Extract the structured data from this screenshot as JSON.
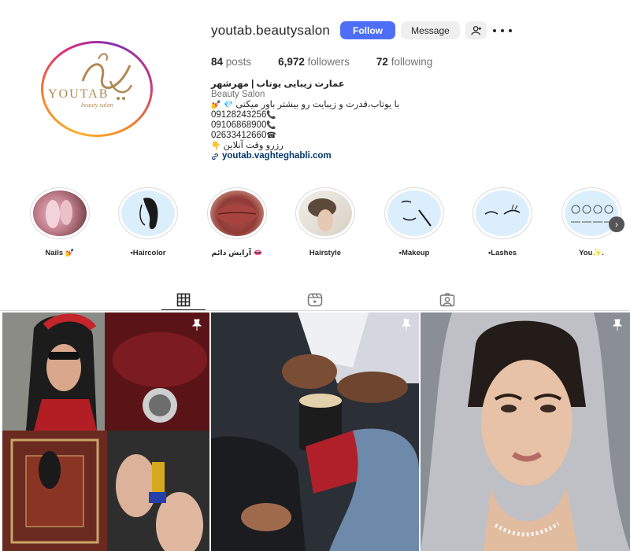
{
  "profile": {
    "username": "youtab.beautysalon",
    "avatar_logo_text": "YOUTAB",
    "avatar_logo_sub": "beauty salon",
    "buttons": {
      "follow": "Follow",
      "message": "Message"
    },
    "stats": {
      "posts_count": "84",
      "posts_label": "posts",
      "followers_count": "6,972",
      "followers_label": "followers",
      "following_count": "72",
      "following_label": "following"
    },
    "bio": {
      "name": "عمارت زیبایی یوتاب | مهرشهر",
      "category": "Beauty Salon",
      "line1": "با یوتاب،قدرت و زیبایت رو بیشتر باور میکنی",
      "phone1": "09128243256",
      "phone2": "09106868900",
      "phone3": "02633412660",
      "booking": "رزرو وقت آنلاین",
      "link": "youtab.vaghteghabli.com"
    }
  },
  "highlights": [
    {
      "label": "Nails 💅"
    },
    {
      "label": "•Haircolor"
    },
    {
      "label": "آرایش دائم 👄"
    },
    {
      "label": "Hairstyle"
    },
    {
      "label": "•Makeup"
    },
    {
      "label": "•Lashes"
    },
    {
      "label": "You✨."
    }
  ],
  "tabs": [
    "posts-grid-icon",
    "reels-icon",
    "tagged-icon"
  ],
  "colors": {
    "follow": "#4f6ef7",
    "link": "#00376b",
    "accent_gold": "#b08a55"
  }
}
